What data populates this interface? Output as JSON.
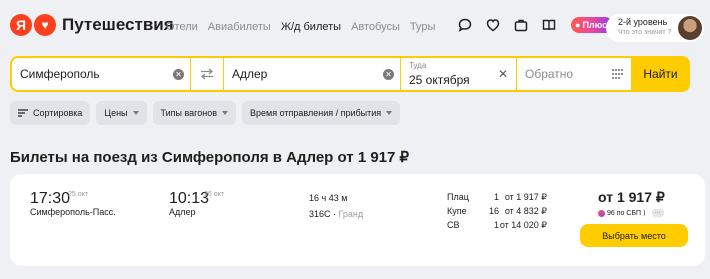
{
  "header": {
    "logo_letter": "Я",
    "brand": "Путешествия",
    "nav": [
      "Отели",
      "Авиабилеты",
      "Ж/д билеты",
      "Автобусы",
      "Туры"
    ],
    "active_nav": "Ж/д билеты",
    "plus_label": "Плюс",
    "level_title": "2-й уровень",
    "level_sub": "Что это значит ?"
  },
  "search": {
    "from": "Симферополь",
    "to": "Адлер",
    "date_label": "Туда",
    "date_value": "25 октября",
    "return_placeholder": "Обратно",
    "find_label": "Найти"
  },
  "filters": [
    {
      "label": "Сортировка"
    },
    {
      "label": "Цены"
    },
    {
      "label": "Типы вагонов"
    },
    {
      "label": "Время отправления / прибытия"
    }
  ],
  "page_title": "Билеты на поезд из Симферополя в Адлер от 1 917 ₽",
  "result": {
    "departure_time": "17:30",
    "departure_date": "25 окт",
    "departure_station": "Симферополь-Пасс.",
    "arrival_time": "10:13",
    "arrival_date": "26 окт",
    "arrival_station": "Адлер",
    "duration": "16 ч 43 м",
    "train_number": "316С",
    "train_brand": "Гранд",
    "seats": [
      {
        "class": "Плац",
        "count": "1",
        "price": "от 1 917 ₽"
      },
      {
        "class": "Купе",
        "count": "16",
        "price": "от 4 832 ₽"
      },
      {
        "class": "СВ",
        "count": "1",
        "price": "от 14 020 ₽"
      }
    ],
    "min_price": "от 1 917 ₽",
    "sbp_text": "96 по СБП",
    "sbp_more": "···",
    "choose_label": "Выбрать место"
  }
}
